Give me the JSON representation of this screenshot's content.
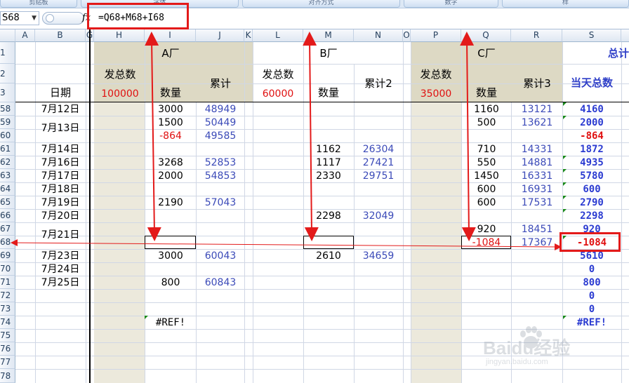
{
  "ribbon": {
    "groups": [
      {
        "label": "剪贴板"
      },
      {
        "label": "字体"
      },
      {
        "label": "对齐方式"
      },
      {
        "label": "数字"
      },
      {
        "label": "样"
      }
    ]
  },
  "formula_bar": {
    "cell_ref": "S68",
    "fx": "fx",
    "formula": "=Q68+M68+I68"
  },
  "columns": [
    "A",
    "B",
    "G",
    "H",
    "I",
    "J",
    "K",
    "L",
    "M",
    "N",
    "O",
    "P",
    "Q",
    "R",
    "S"
  ],
  "row_numbers": [
    "1",
    "2",
    "3",
    "58",
    "59",
    "60",
    "61",
    "62",
    "63",
    "64",
    "65",
    "66",
    "67",
    "68",
    "69",
    "70",
    "71",
    "72",
    "73",
    "74",
    "75",
    "76",
    "77",
    "78"
  ],
  "headers": {
    "factory_a": "A厂",
    "factory_b": "B厂",
    "factory_c": "C厂",
    "total": "总计",
    "date_label": "日期",
    "dispatch_total": "发总数",
    "quantity": "数量",
    "cumulative_a": "累计",
    "cumulative_b": "累计2",
    "cumulative_c": "累计3",
    "daily_total": "当天总数",
    "a_total": "100000",
    "b_total": "60000",
    "c_total": "35000"
  },
  "cells": {
    "b58": "7月12日",
    "b59": "7月13日",
    "b61": "7月14日",
    "b62": "7月16日",
    "b63": "7月17日",
    "b64": "7月18日",
    "b65": "7月19日",
    "b66": "7月20日",
    "b67": "7月21日",
    "b69": "7月23日",
    "b70": "7月24日",
    "b71": "7月25日",
    "i58": "3000",
    "i59": "1500",
    "i60": "-864",
    "i62": "3268",
    "i63": "2000",
    "i65": "2190",
    "i69": "3000",
    "i71": "800",
    "i74": "#REF!",
    "j58": "48949",
    "j59": "50449",
    "j60": "49585",
    "j62": "52853",
    "j63": "54853",
    "j65": "57043",
    "j69": "60043",
    "j71": "60843",
    "m61": "1162",
    "m62": "1117",
    "m63": "2330",
    "m66": "2298",
    "m69": "2610",
    "n61": "26304",
    "n62": "27421",
    "n63": "29751",
    "n66": "32049",
    "n69": "34659",
    "q58": "1160",
    "q59": "500",
    "q61": "710",
    "q62": "550",
    "q63": "1450",
    "q64": "600",
    "q65": "600",
    "q67": "920",
    "q68": "-1084",
    "r58": "13121",
    "r59": "13621",
    "r61": "14331",
    "r62": "14881",
    "r63": "16331",
    "r64": "16931",
    "r65": "17531",
    "r67": "18451",
    "r68": "17367",
    "s58": "4160",
    "s59": "2000",
    "s60": "-864",
    "s61": "1872",
    "s62": "4935",
    "s63": "5780",
    "s64": "600",
    "s65": "2790",
    "s66": "2298",
    "s67": "920",
    "s68": "-1084",
    "s69": "5610",
    "s70": "0",
    "s71": "800",
    "s72": "0",
    "s73": "0",
    "s74": "#REF!"
  },
  "colors": {
    "annotation_red": "#e31a1a",
    "header_fill": "#ddd9c4",
    "value_blue": "#3b4ab8",
    "total_blue": "#2b3bd1",
    "negative_red": "#e01010"
  },
  "watermark": {
    "brand": "Baidu经验",
    "url": "jingyan.baidu.com"
  }
}
